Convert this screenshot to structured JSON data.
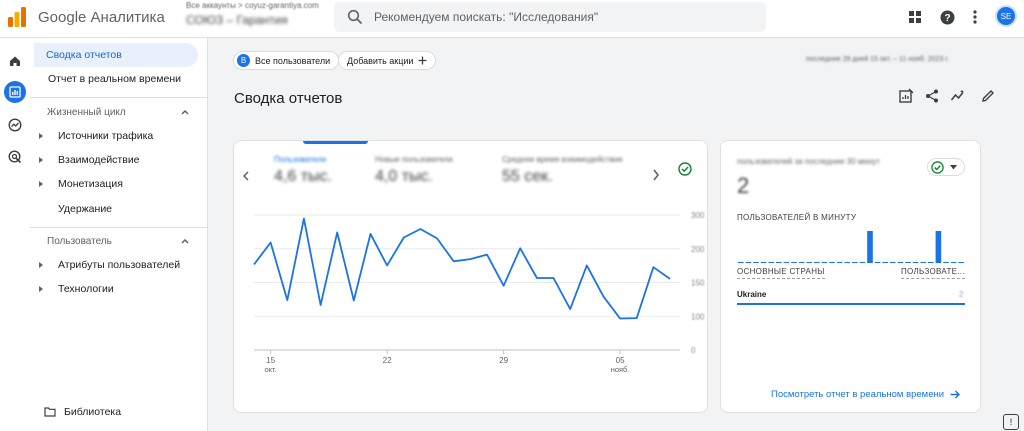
{
  "app": {
    "name": "Google Аналитика",
    "account_path": "Все аккаунты > coyuz-garantiya.com",
    "property_name": "СОЮЗ – Гарантия",
    "search_placeholder": "Рекомендуем поискать: \"Исследования\"",
    "avatar_initials": "SE"
  },
  "rail": {
    "items": [
      "home-icon",
      "reports-icon",
      "explore-icon",
      "advertising-icon"
    ],
    "active": "reports-icon"
  },
  "nav": {
    "top_items": [
      "Сводка отчетов",
      "Отчет в реальном времени"
    ],
    "active": "Сводка отчетов",
    "lifecycle": {
      "title": "Жизненный цикл",
      "items": [
        "Источники трафика",
        "Взаимодействие",
        "Монетизация",
        "Удержание"
      ]
    },
    "user": {
      "title": "Пользователь",
      "items": [
        "Атрибуты пользователей",
        "Технологии"
      ]
    },
    "library": "Библиотека"
  },
  "filters": {
    "segment_badge": "B",
    "segment_label": "Все пользователи",
    "add_label": "Добавить акции",
    "date_range": "последние 28 дней  15 окт. – 11 нояб. 2023 г."
  },
  "page": {
    "title": "Сводка отчетов"
  },
  "metrics": [
    {
      "label": "Пользователи",
      "value": "4,6 тыс."
    },
    {
      "label": "Новые пользователи",
      "value": "4,0 тыс."
    },
    {
      "label": "Средняя время взаимодействия",
      "value": "55 сек."
    }
  ],
  "chart_data": {
    "type": "line",
    "x_ticks": [
      {
        "day": "15",
        "month": "окт."
      },
      {
        "day": "22",
        "month": ""
      },
      {
        "day": "29",
        "month": ""
      },
      {
        "day": "05",
        "month": "нояб."
      }
    ],
    "y_ticks": [
      "300",
      "200",
      "150",
      "100",
      "0"
    ],
    "ylim": [
      0,
      300
    ],
    "grid": true,
    "values": [
      190,
      239,
      111,
      292,
      100,
      261,
      110,
      258,
      188,
      250,
      269,
      248,
      197,
      202,
      212,
      143,
      226,
      160,
      160,
      91,
      188,
      119,
      70,
      71,
      184,
      158
    ],
    "color": "#1a73e8"
  },
  "realtime": {
    "title": "пользователей за последние 30 минут",
    "count": "2",
    "per_minute_label": "ПОЛЬЗОВАТЕЛЕЙ В МИНУТУ",
    "bars": [
      0,
      0,
      0,
      0,
      0,
      0,
      0,
      0,
      0,
      0,
      0,
      0,
      0,
      0,
      0,
      0,
      0,
      1,
      0,
      0,
      0,
      0,
      0,
      0,
      0,
      0,
      1,
      0,
      0,
      0
    ],
    "col_country": "ОСНОВНЫЕ СТРАНЫ",
    "col_users": "ПОЛЬЗОВАТЕ...",
    "country": "Ukraine",
    "country_value": "2",
    "link": "Посмотреть отчет в реальном времени"
  }
}
